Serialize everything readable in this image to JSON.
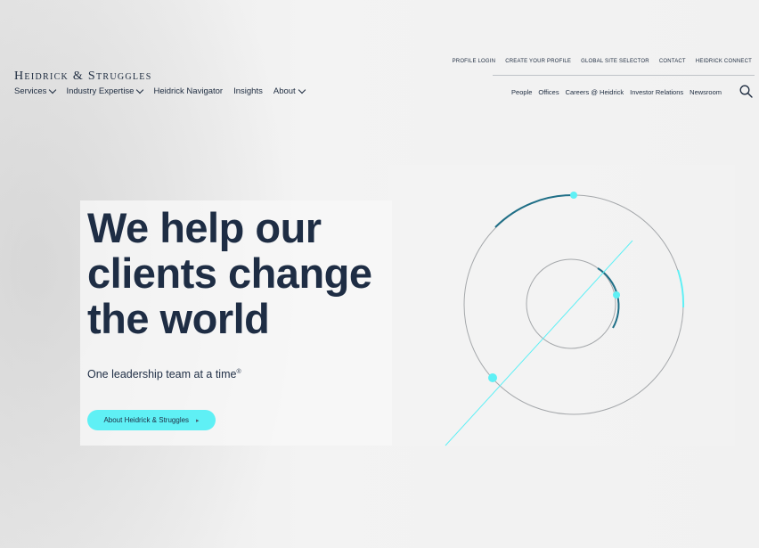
{
  "brand": {
    "logo_text": "Heidrick & Struggles"
  },
  "main_nav": [
    {
      "label": "Services",
      "has_dropdown": true
    },
    {
      "label": "Industry Expertise",
      "has_dropdown": true
    },
    {
      "label": "Heidrick Navigator",
      "has_dropdown": false
    },
    {
      "label": "Insights",
      "has_dropdown": false
    },
    {
      "label": "About",
      "has_dropdown": true
    }
  ],
  "utility_nav": [
    "PROFILE LOGIN",
    "CREATE YOUR PROFILE",
    "GLOBAL SITE SELECTOR",
    "CONTACT",
    "HEIDRICK CONNECT"
  ],
  "secondary_nav": [
    "People",
    "Offices",
    "Careers @ Heidrick",
    "Investor Relations",
    "Newsroom"
  ],
  "hero": {
    "headline_lines": [
      "We help our",
      "clients change",
      "the world"
    ],
    "tagline": "One leadership team at a time",
    "tagline_mark": "®",
    "cta_label": "About Heidrick & Struggles",
    "cta_arrow": "▸"
  },
  "colors": {
    "accent": "#5ff0f5",
    "dark_teal": "#1f6f87",
    "text": "#1e2d44",
    "ring": "#a5a8ab"
  },
  "icons": {
    "search": "search-icon",
    "dropdown": "chevron-down-icon"
  }
}
